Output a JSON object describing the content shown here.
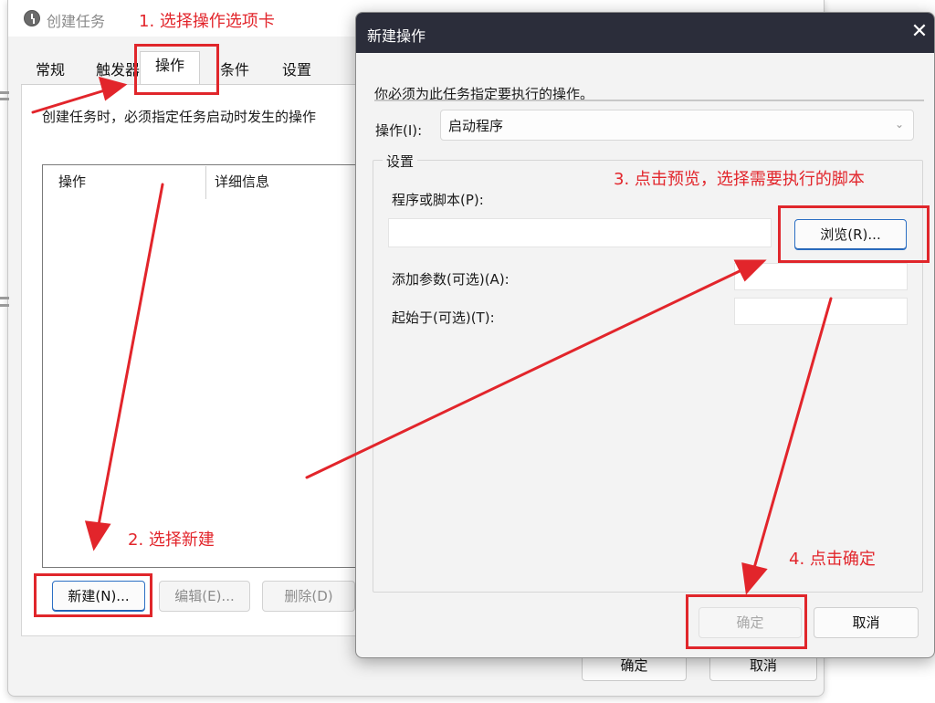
{
  "create_task": {
    "title": "创建任务",
    "tabs": [
      "常规",
      "触发器",
      "操作",
      "条件",
      "设置"
    ],
    "description": "创建任务时，必须指定任务启动时发生的操作",
    "columns": {
      "action": "操作",
      "detail": "详细信息"
    },
    "buttons": {
      "new": "新建(N)...",
      "edit": "编辑(E)...",
      "delete": "删除(D)",
      "ok": "确定",
      "cancel": "取消"
    }
  },
  "new_action": {
    "title": "新建操作",
    "close_glyph": "✕",
    "instruction": "你必须为此任务指定要执行的操作。",
    "action_label": "操作(I):",
    "action_value": "启动程序",
    "chevron": "⌄",
    "settings_label": "设置",
    "program_label": "程序或脚本(P):",
    "program_value": "",
    "browse": "浏览(R)...",
    "args_label": "添加参数(可选)(A):",
    "args_value": "",
    "start_label": "起始于(可选)(T):",
    "start_value": "",
    "ok": "确定",
    "cancel": "取消"
  },
  "annotations": {
    "step1": "1. 选择操作选项卡",
    "step2": "2. 选择新建",
    "step3": "3. 点击预览，选择需要执行的脚本",
    "step4": "4. 点击确定",
    "color": "#e2252b"
  },
  "icons": {
    "task_icon": "clock-icon",
    "close": "close-icon",
    "dropdown": "chevron-down-icon"
  },
  "colors": {
    "titlebar_dark": "#2b2d3a",
    "accent_blue": "#2b6fc4",
    "window_bg": "#f3f3f3"
  }
}
